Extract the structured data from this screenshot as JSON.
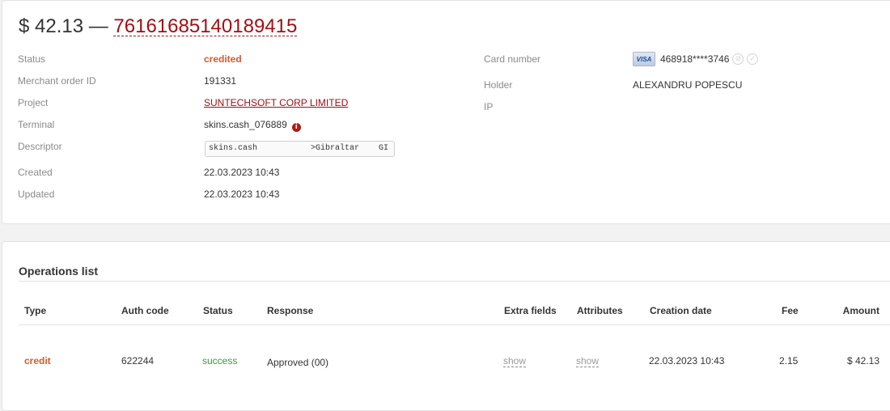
{
  "header": {
    "amount": "$ 42.13",
    "separator": "—",
    "transaction_id": "76161685140189415"
  },
  "details": {
    "status_label": "Status",
    "status_value": "credited",
    "merchant_order_label": "Merchant order ID",
    "merchant_order_value": "191331",
    "project_label": "Project",
    "project_value": "SUNTECHSOFT CORP LIMITED",
    "terminal_label": "Terminal",
    "terminal_value": "skins.cash_076889",
    "descriptor_label": "Descriptor",
    "descriptor_value": "skins.cash           >Gibraltar    GI",
    "created_label": "Created",
    "created_value": "22.03.2023 10:43",
    "updated_label": "Updated",
    "updated_value": "22.03.2023 10:43"
  },
  "card": {
    "number_label": "Card number",
    "brand": "VISA",
    "number_value": "468918****3746",
    "holder_label": "Holder",
    "holder_value": "ALEXANDRU POPESCU",
    "ip_label": "IP"
  },
  "operations": {
    "title": "Operations list",
    "columns": {
      "type": "Type",
      "auth_code": "Auth code",
      "status": "Status",
      "response": "Response",
      "extra_fields": "Extra fields",
      "attributes": "Attributes",
      "creation_date": "Creation date",
      "fee": "Fee",
      "amount": "Amount"
    },
    "rows": [
      {
        "type": "credit",
        "auth_code": "622244",
        "status": "success",
        "response": "Approved (00)",
        "extra_fields": "show",
        "attributes": "show",
        "creation_date": "22.03.2023 10:43",
        "fee": "2.15",
        "amount": "$ 42.13"
      }
    ]
  },
  "colors": {
    "accent_red": "#a30e12",
    "status_orange": "#d65a2a",
    "success_green": "#3a9a3a"
  }
}
